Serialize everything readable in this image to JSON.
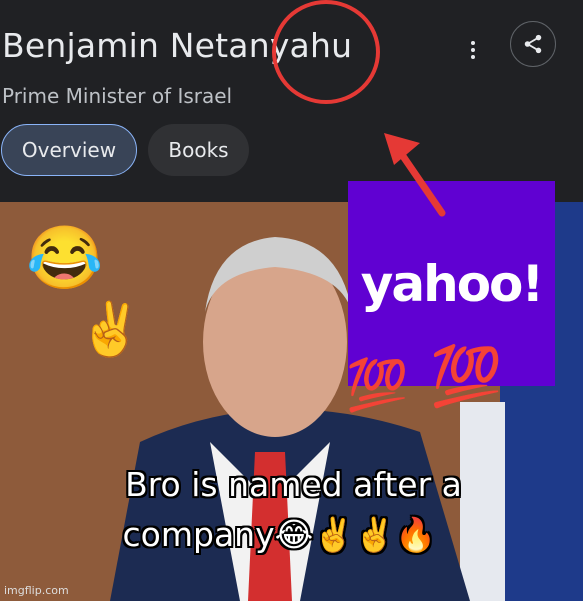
{
  "header": {
    "title": "Benjamin Netanyahu",
    "subtitle": "Prime Minister of Israel",
    "tabs": [
      {
        "label": "Overview",
        "selected": true
      },
      {
        "label": "Books",
        "selected": false
      }
    ],
    "more_icon": "more-vert-icon",
    "share_icon": "share-icon"
  },
  "overlay": {
    "logo_text": "yahoo!",
    "logo_color": "#6001d2",
    "highlight_color": "#e53935",
    "caption_line1": "Bro is named after a",
    "caption_line2": "company😂✌️✌️🔥",
    "emojis": [
      "😂",
      "✌️",
      "💯",
      "💯"
    ],
    "watermark": "imgflip.com"
  }
}
